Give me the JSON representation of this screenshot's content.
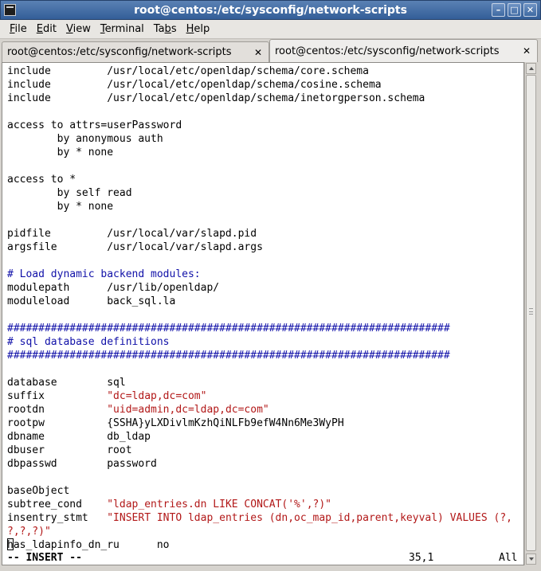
{
  "window": {
    "title": "root@centos:/etc/sysconfig/network-scripts",
    "buttons": {
      "minimize": "–",
      "maximize": "□",
      "close": "✕"
    }
  },
  "menubar": {
    "items": [
      {
        "pre": "",
        "ul": "F",
        "post": "ile"
      },
      {
        "pre": "",
        "ul": "E",
        "post": "dit"
      },
      {
        "pre": "",
        "ul": "V",
        "post": "iew"
      },
      {
        "pre": "",
        "ul": "T",
        "post": "erminal"
      },
      {
        "pre": "Ta",
        "ul": "b",
        "post": "s"
      },
      {
        "pre": "",
        "ul": "H",
        "post": "elp"
      }
    ]
  },
  "tabs": [
    {
      "label": "root@centos:/etc/sysconfig/network-scripts",
      "close": "✕",
      "active": false
    },
    {
      "label": "root@centos:/etc/sysconfig/network-scripts",
      "close": "✕",
      "active": true
    }
  ],
  "terminal": {
    "lines": [
      {
        "text": "include         /usr/local/etc/openldap/schema/core.schema"
      },
      {
        "text": "include         /usr/local/etc/openldap/schema/cosine.schema"
      },
      {
        "text": "include         /usr/local/etc/openldap/schema/inetorgperson.schema"
      },
      {
        "text": ""
      },
      {
        "text": "access to attrs=userPassword"
      },
      {
        "text": "        by anonymous auth"
      },
      {
        "text": "        by * none"
      },
      {
        "text": ""
      },
      {
        "text": "access to *"
      },
      {
        "text": "        by self read"
      },
      {
        "text": "        by * none"
      },
      {
        "text": ""
      },
      {
        "text": "pidfile         /usr/local/var/slapd.pid"
      },
      {
        "text": "argsfile        /usr/local/var/slapd.args"
      },
      {
        "text": ""
      },
      {
        "text": "# Load dynamic backend modules:",
        "style": "comment"
      },
      {
        "text": "modulepath      /usr/lib/openldap/"
      },
      {
        "text": "moduleload      back_sql.la"
      },
      {
        "text": ""
      },
      {
        "text": "#######################################################################",
        "style": "comment"
      },
      {
        "text": "# sql database definitions",
        "style": "comment"
      },
      {
        "text": "#######################################################################",
        "style": "comment"
      },
      {
        "text": ""
      },
      {
        "text": "database        sql"
      },
      {
        "key": "suffix          ",
        "value": "\"dc=ldap,dc=com\""
      },
      {
        "key": "rootdn          ",
        "value": "\"uid=admin,dc=ldap,dc=com\""
      },
      {
        "text": "rootpw          {SSHA}yLXDivlmKzhQiNLFb9efW4Nn6Me3WyPH"
      },
      {
        "text": "dbname          db_ldap"
      },
      {
        "text": "dbuser          root"
      },
      {
        "text": "dbpasswd        password"
      },
      {
        "text": ""
      },
      {
        "text": "baseObject"
      },
      {
        "key": "subtree_cond    ",
        "value": "\"ldap_entries.dn LIKE CONCAT('%',?)\""
      },
      {
        "key": "insentry_stmt   ",
        "value": "\"INSERT INTO ldap_entries (dn,oc_map_id,parent,keyval) VALUES (?,"
      },
      {
        "key": "",
        "value": "?,?,?)\""
      },
      {
        "cursor": "h",
        "text": "as_ldapinfo_dn_ru      no"
      }
    ],
    "status": {
      "mode": "-- INSERT --",
      "position": "35,1",
      "scroll": "All"
    }
  },
  "colors": {
    "comment": "#1010a8",
    "string": "#b21818",
    "titlebar": "#335e98"
  }
}
